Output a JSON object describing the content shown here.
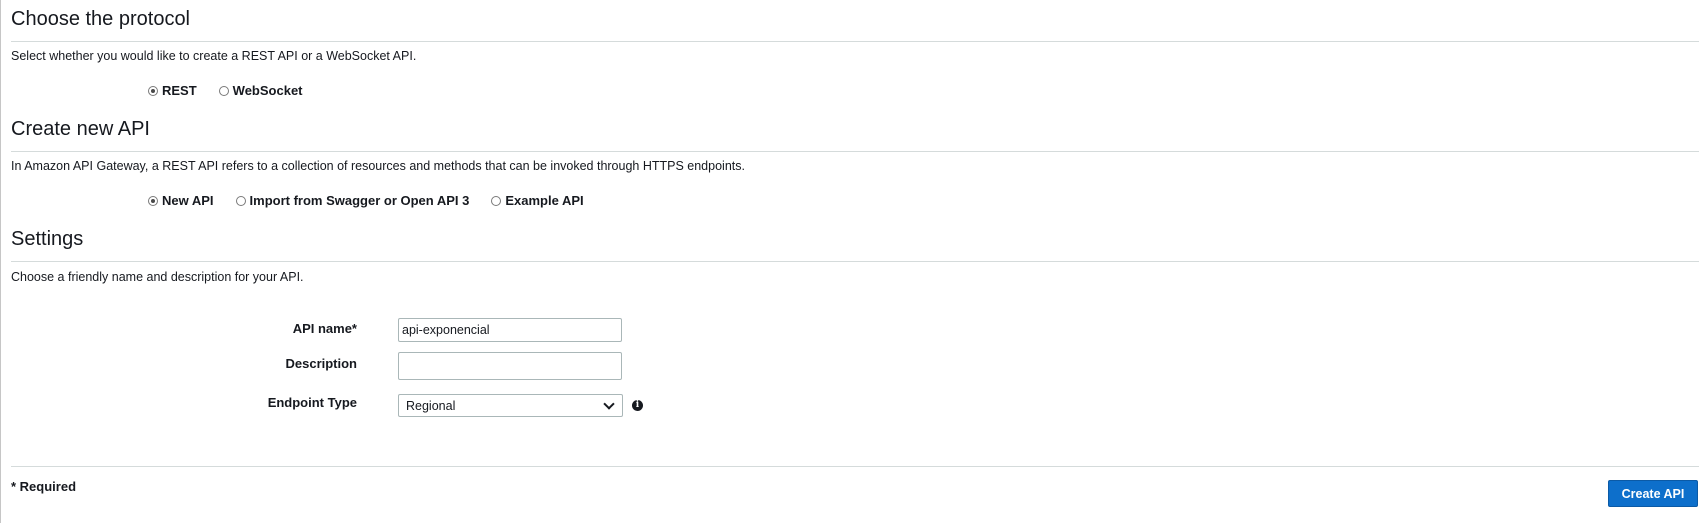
{
  "protocol": {
    "title": "Choose the protocol",
    "description": "Select whether you would like to create a REST API or a WebSocket API.",
    "options": [
      {
        "label": "REST",
        "checked": true
      },
      {
        "label": "WebSocket",
        "checked": false
      }
    ]
  },
  "create": {
    "title": "Create new API",
    "description": "In Amazon API Gateway, a REST API refers to a collection of resources and methods that can be invoked through HTTPS endpoints.",
    "options": [
      {
        "label": "New API",
        "checked": true
      },
      {
        "label": "Import from Swagger or Open API 3",
        "checked": false
      },
      {
        "label": "Example API",
        "checked": false
      }
    ]
  },
  "settings": {
    "title": "Settings",
    "description": "Choose a friendly name and description for your API.",
    "api_name_label": "API name*",
    "api_name_value": "api-exponencial",
    "description_label": "Description",
    "description_value": "",
    "endpoint_label": "Endpoint Type",
    "endpoint_value": "Regional",
    "info_icon": "info-icon"
  },
  "footer": {
    "required_note": "* Required",
    "create_button": "Create API"
  },
  "colors": {
    "primary_button": "#0d6fcb",
    "divider": "#d5dbdb"
  }
}
